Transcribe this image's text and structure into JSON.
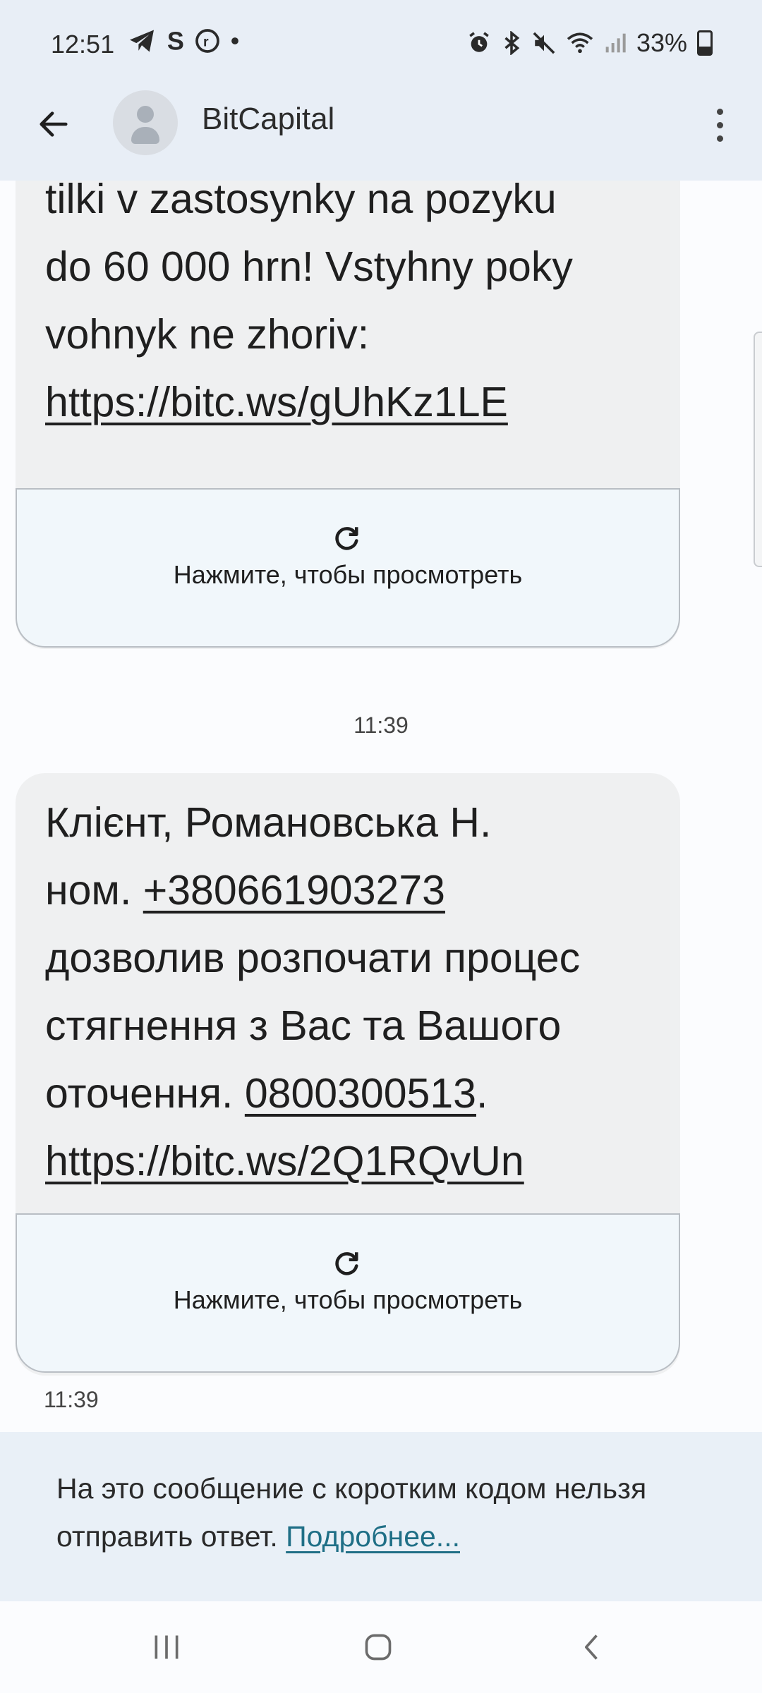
{
  "status_bar": {
    "time": "12:51",
    "battery": "33%",
    "left_icons": [
      "telegram-icon",
      "s-app-icon",
      "r-app-icon",
      "dot-icon"
    ],
    "right_icons": [
      "alarm-icon",
      "bluetooth-icon",
      "mute-icon",
      "wifi-icon",
      "signal-icon",
      "battery-icon"
    ]
  },
  "app_bar": {
    "title": "BitCapital"
  },
  "messages": [
    {
      "lines": [
        "tilki v zastosynky na pozyku",
        "do 60 000 hrn! Vstyhny poky",
        "vohnyk ne zhoriv:"
      ],
      "link": "https://bitc.ws/gUhKz1LE",
      "preview_label": "Нажмите, чтобы просмотреть"
    },
    {
      "timestamp_before": "11:39",
      "line1": "Клієнт,  Романовська Н.",
      "line2_prefix": "ном. ",
      "phone": "+380661903273",
      "line3": "дозволив розпочати процес",
      "line4": "стягнення з Вас та Вашого",
      "line5_prefix": "оточення. ",
      "hotline": "0800300513",
      "line5_suffix": ".",
      "link": "https://bitc.ws/2Q1RQvUn",
      "preview_label": "Нажмите, чтобы просмотреть",
      "timestamp_after": "11:39"
    }
  ],
  "notice": {
    "text": "На это сообщение с коротким кодом нельзя отправить ответ. ",
    "link": "Подробнее..."
  },
  "nav_bar": {
    "buttons": [
      "recent-apps-icon",
      "home-icon",
      "back-icon"
    ]
  }
}
